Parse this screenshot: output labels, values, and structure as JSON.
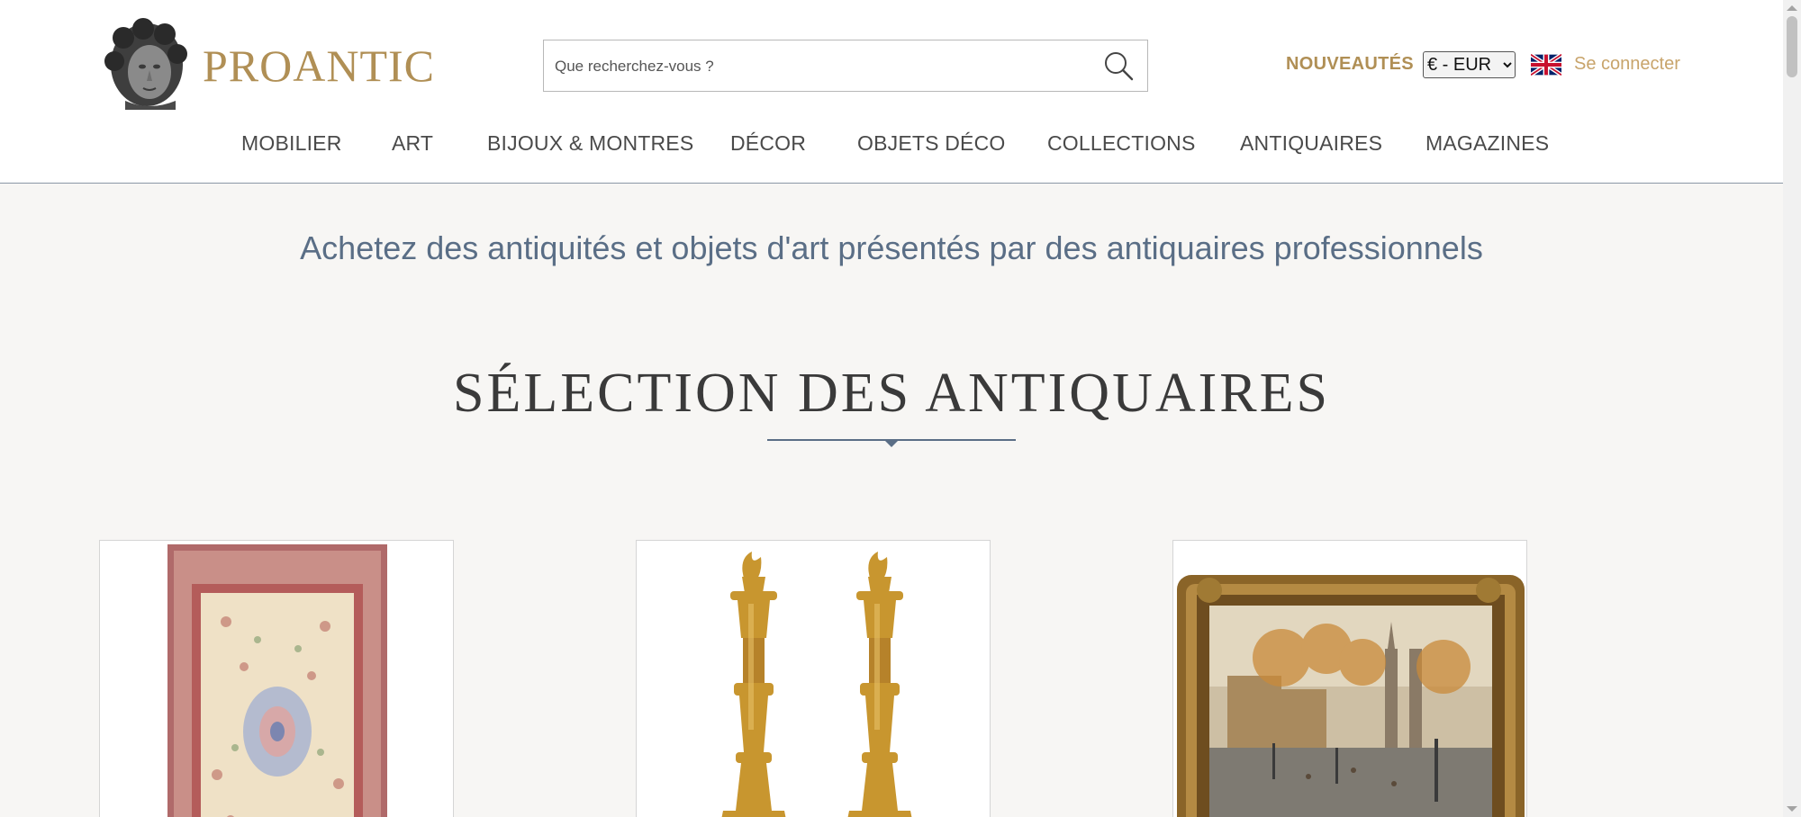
{
  "header": {
    "logo_text": "PROANTIC",
    "search": {
      "placeholder": "Que recherchez-vous ?",
      "value": ""
    },
    "nouveautes_label": "NOUVEAUTÉS",
    "currency": {
      "selected": "€ - EUR"
    },
    "language_flag": "uk-flag-icon",
    "login_label": "Se connecter"
  },
  "nav": {
    "items": [
      {
        "label": "MOBILIER"
      },
      {
        "label": "ART"
      },
      {
        "label": "BIJOUX & MONTRES"
      },
      {
        "label": "DÉCOR"
      },
      {
        "label": "OBJETS DÉCO"
      },
      {
        "label": "COLLECTIONS"
      },
      {
        "label": "ANTIQUAIRES"
      },
      {
        "label": "MAGAZINES"
      }
    ]
  },
  "main": {
    "tagline": "Achetez des antiquités et objets d'art présentés par des antiquaires professionnels",
    "section_title": "SÉLECTION DES ANTIQUAIRES",
    "cards": [
      {
        "image": "persian-rug-image"
      },
      {
        "image": "gilt-bronze-candlesticks-image"
      },
      {
        "image": "framed-paris-painting-image"
      }
    ]
  },
  "colors": {
    "brand_gold": "#b08f55",
    "login_gold": "#c8a46b",
    "tagline_blue": "#5a6e86",
    "page_bg": "#f7f6f4"
  }
}
